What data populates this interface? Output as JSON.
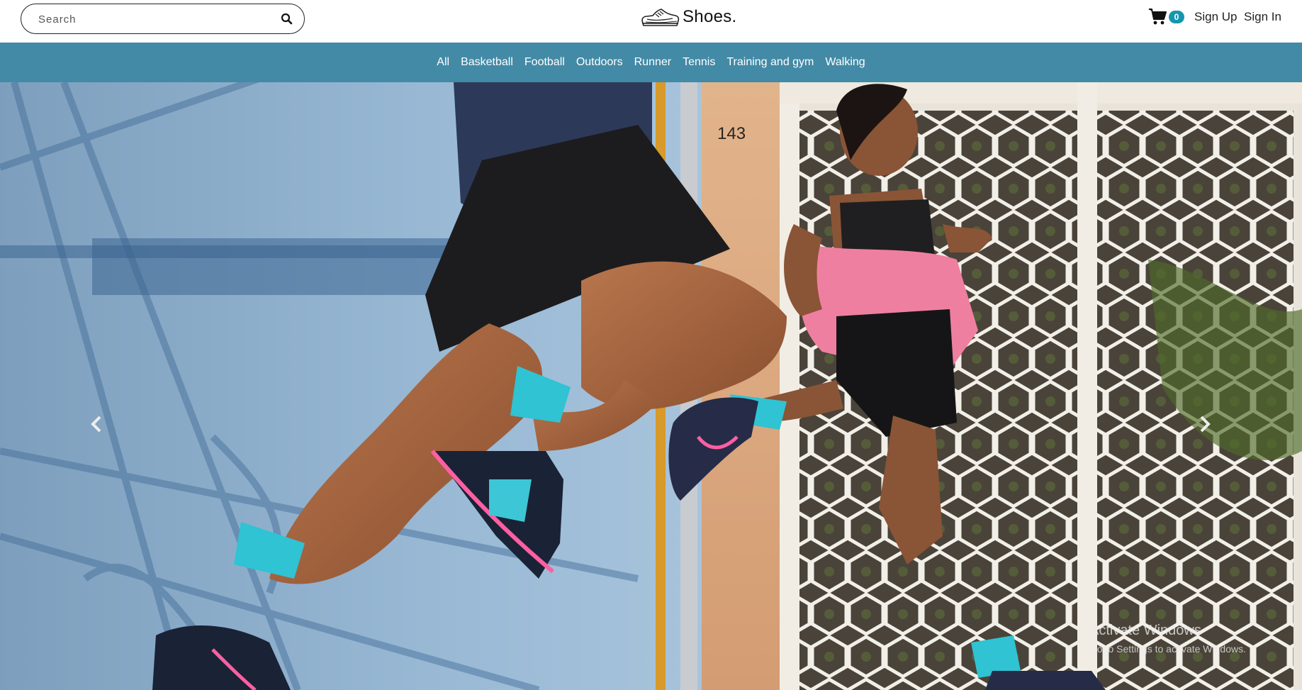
{
  "header": {
    "search_placeholder": "Search",
    "brand_name": "Shoes.",
    "cart_count": "0",
    "signup_label": "Sign Up",
    "signin_label": "Sign In"
  },
  "categories": [
    "All",
    "Basketball",
    "Football",
    "Outdoors",
    "Runner",
    "Tennis",
    "Training and gym",
    "Walking"
  ],
  "hero": {
    "house_number": "143"
  },
  "watermark": {
    "title": "Activate Windows",
    "subtitle": "Go to Settings to activate Windows."
  },
  "icons": {
    "search": "search-icon",
    "logo": "sneaker-logo-icon",
    "cart": "cart-icon",
    "prev": "chevron-left-icon",
    "next": "chevron-right-icon"
  },
  "colors": {
    "nav_bg": "#438aa6",
    "badge": "#1696ad",
    "text": "#222222"
  }
}
